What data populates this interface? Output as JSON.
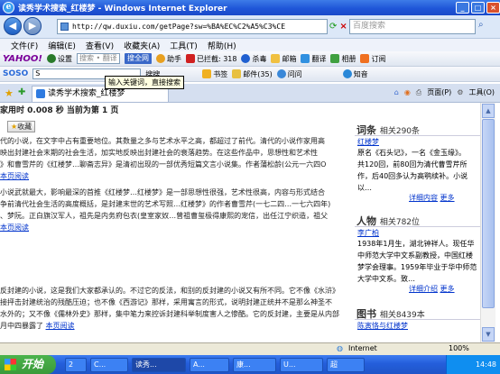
{
  "window": {
    "title": "读秀学术搜索_红楼梦 - Windows Internet Explorer",
    "min": "_",
    "max": "□",
    "close": "×"
  },
  "address": {
    "url": "http://qw.duxiu.com/getPage?sw=%BA%EC%C2%A5%C3%CE",
    "back": "◀",
    "fwd": "▶"
  },
  "search_box": {
    "placeholder": "百度搜索"
  },
  "menu": [
    "文件(F)",
    "编辑(E)",
    "查看(V)",
    "收藏夹(A)",
    "工具(T)",
    "帮助(H)"
  ],
  "yahoo_bar": {
    "logo": "YAHOO!",
    "settings": "设置",
    "search_placeholder": "搜索 • 翻译",
    "search_btn": "搜全网",
    "items": [
      "助手",
      "已拦截: 318",
      "杀毒",
      "邮箱",
      "翻译",
      "相册",
      "订阅"
    ]
  },
  "soso_bar": {
    "logo": "SOSO",
    "input": "S",
    "search_btn": "搜搜",
    "items": [
      "书签",
      "邮件(35)",
      "问问",
      "知音"
    ]
  },
  "tooltip": "输入关键词，直接搜索",
  "tab": {
    "title": "读秀学术搜索_红楼梦",
    "right_items": [
      "页面(P)",
      "工具(O)"
    ]
  },
  "content": {
    "top_line": "家用时 0.008 秒    当前为第 1 页",
    "collect": "收藏",
    "p1": [
      "代的小说，在文字中占有重要地位。其数量之多与艺术水平之高，都超过了前代。清代的小说作家用高",
      "映出封建社会末期的社会生活，加实地反映出封建社会的衰落趋势。在这些作品中，思想性和艺术性",
      "》和曹雪芹的《红楼梦…聊斋志异》是清初出现的一部优秀短篇文言小说集。作者蒲松龄(公元一六四O"
    ],
    "p1_link": "本页阅读",
    "p2": [
      "小说武就最大，影响最深的首推《红楼梦…红楼梦》是一部思想性很强，艺术性很高，内容与形式结合",
      "争前清代社会生活的高度概括，是封建末世的艺术写照…红楼梦》的作者曹雪芹(一七二四…一七六四年)",
      "、梦阮。正白旗汉军人，祖先是内务府包衣(皇室家奴…曾祖曹玺极得康熙的宠信，出任江宁织造，祖父"
    ],
    "p2_link": "本页阅读",
    "p3": [
      "反封建的小说，这是我们大家都承认的。不过它的反法，和别的反封建的小说又有所不同。它不像《水浒》",
      "接抨击封建统治的残酷压迫；也不像《西游记》那样，采用寓言的形式，说明封建正统并不是那么神圣不",
      "水外的；又不像《儒林外史》那样，集中笔力来控诉封建科举制度害人之惨酷。它的反封建，主要是从内部"
    ],
    "p3_tail": "月中四暴露了",
    "p3_link": "本页阅读"
  },
  "sidebar": {
    "ci": {
      "head": "词条",
      "count": "相关290条",
      "link": "红楼梦",
      "text": [
        "原名《石头记》，一名《金玉缘》。",
        "共120回，前80回为清代曹雪芹所",
        "作，后40回多认为高鹗续补。小说",
        "以…"
      ],
      "detail": "详细内容",
      "more": "更多"
    },
    "ren": {
      "head": "人物",
      "count": "相关782位",
      "link": "李广柏",
      "text": [
        "1938年1月生，湖北钟祥人。现任华",
        "中师范大学中文系副教授，中国红楼",
        "梦学会理事。1959年毕业于华中师范",
        "大学中文系。致…"
      ],
      "detail": "详细介绍",
      "more": "更多"
    },
    "tu": {
      "head": "图书",
      "count": "相关8439本",
      "link": "陈寅恪与红楼梦"
    }
  },
  "status": {
    "text": "Internet",
    "zoom": "100%"
  },
  "taskbar": {
    "start": "开始",
    "tasks": [
      "2",
      "C...",
      "读秀...",
      "A...",
      "康...",
      "U...",
      "超"
    ],
    "clock": "14:48"
  }
}
